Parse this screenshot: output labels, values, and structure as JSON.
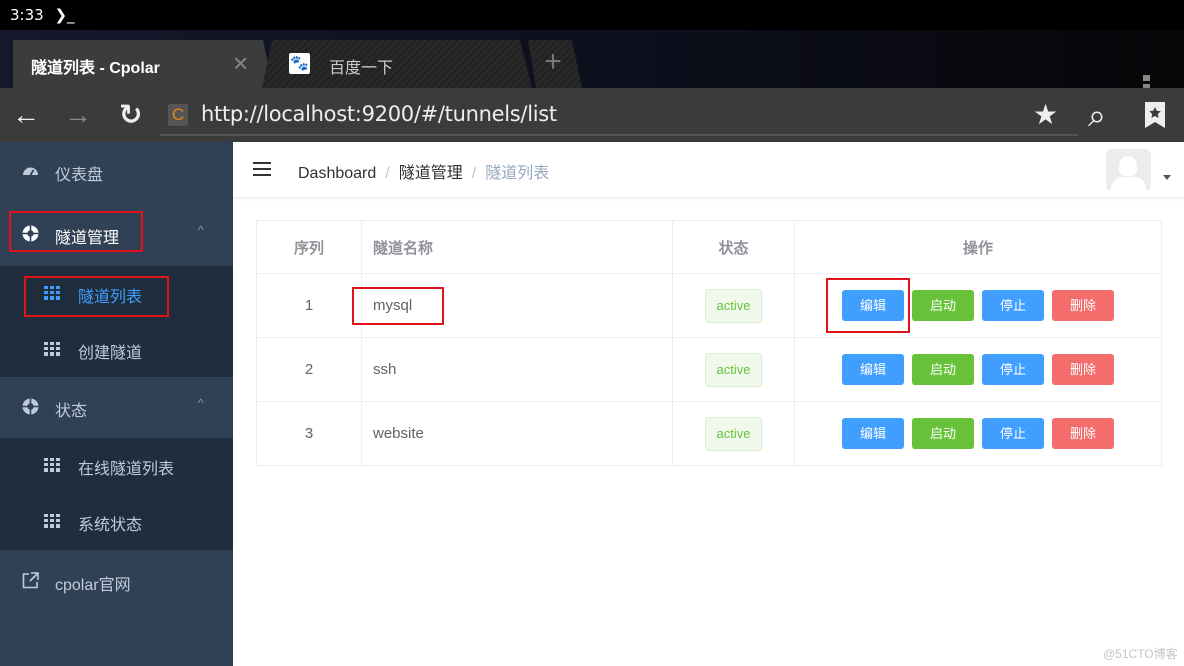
{
  "status_bar": {
    "time": "3:33",
    "terminal_glyph": "❯_"
  },
  "browser": {
    "tabs": [
      {
        "title": "隧道列表 - Cpolar",
        "active": true,
        "close_icon": "×"
      },
      {
        "title": "百度一下",
        "active": false,
        "favicon": "baidu-paw-icon"
      }
    ],
    "new_tab_label": "+",
    "url": "http://localhost:9200/#/tunnels/list",
    "url_favicon_letter": "C",
    "icons": {
      "back": "←",
      "forward": "→",
      "reload": "↻",
      "star": "★",
      "search": "⌕",
      "bookmarks": "🔖"
    }
  },
  "sidebar": {
    "items": [
      {
        "label": "仪表盘",
        "icon": "dashboard-icon"
      },
      {
        "label": "隧道管理",
        "icon": "lifebuoy-icon",
        "expanded": true,
        "highlighted": true,
        "children": [
          {
            "label": "隧道列表",
            "icon": "table-icon",
            "active": true,
            "highlighted": true
          },
          {
            "label": "创建隧道",
            "icon": "table-icon"
          }
        ]
      },
      {
        "label": "状态",
        "icon": "lifebuoy-icon",
        "expanded": true,
        "children": [
          {
            "label": "在线隧道列表",
            "icon": "table-icon"
          },
          {
            "label": "系统状态",
            "icon": "table-icon"
          }
        ]
      },
      {
        "label": "cpolar官网",
        "icon": "external-link-icon"
      }
    ],
    "chevron": "^"
  },
  "navbar": {
    "breadcrumb": [
      "Dashboard",
      "隧道管理",
      "隧道列表"
    ],
    "separator": "/"
  },
  "table": {
    "columns": [
      "序列",
      "隧道名称",
      "状态",
      "操作"
    ],
    "rows": [
      {
        "index": "1",
        "name": "mysql",
        "status": "active"
      },
      {
        "index": "2",
        "name": "ssh",
        "status": "active"
      },
      {
        "index": "3",
        "name": "website",
        "status": "active"
      }
    ],
    "actions": {
      "edit": "编辑",
      "start": "启动",
      "stop": "停止",
      "delete": "删除"
    }
  },
  "colors": {
    "primary": "#409eff",
    "success": "#67c23a",
    "danger": "#f56c6c",
    "sidebar_bg": "#304156",
    "submenu_bg": "#1f2d3d",
    "highlight_box": "#e0131b"
  },
  "watermark": "@51CTO博客"
}
